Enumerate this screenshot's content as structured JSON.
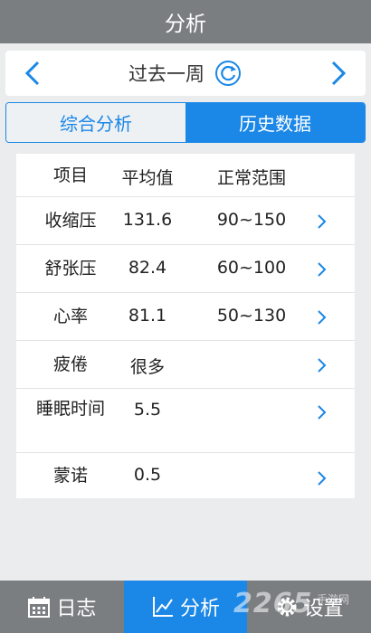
{
  "header": {
    "title": "分析"
  },
  "period": {
    "label": "过去一周",
    "prev_icon": "chevron-left-icon",
    "next_icon": "chevron-right-icon",
    "refresh_icon": "refresh-icon"
  },
  "tabs": [
    {
      "label": "综合分析",
      "active": false
    },
    {
      "label": "历史数据",
      "active": true
    }
  ],
  "table": {
    "headers": [
      "项目",
      "平均值",
      "正常范围"
    ],
    "rows": [
      {
        "item": "收缩压",
        "average": "131.6",
        "range": "90~150"
      },
      {
        "item": "舒张压",
        "average": "82.4",
        "range": "60~100"
      },
      {
        "item": "心率",
        "average": "81.1",
        "range": "50~130"
      },
      {
        "item": "疲倦",
        "average": "很多",
        "range": ""
      },
      {
        "item": "睡眠时间",
        "average": "5.5",
        "range": ""
      },
      {
        "item": "蒙诺",
        "average": "0.5",
        "range": ""
      }
    ]
  },
  "bottom_nav": {
    "journal": "日志",
    "analysis": "分析",
    "settings": "设置"
  },
  "watermark": {
    "text": "2265",
    "sub": "手游网"
  },
  "colors": {
    "accent": "#1b87e6",
    "bar_gray": "#7b7e80",
    "background": "#eaeced"
  }
}
